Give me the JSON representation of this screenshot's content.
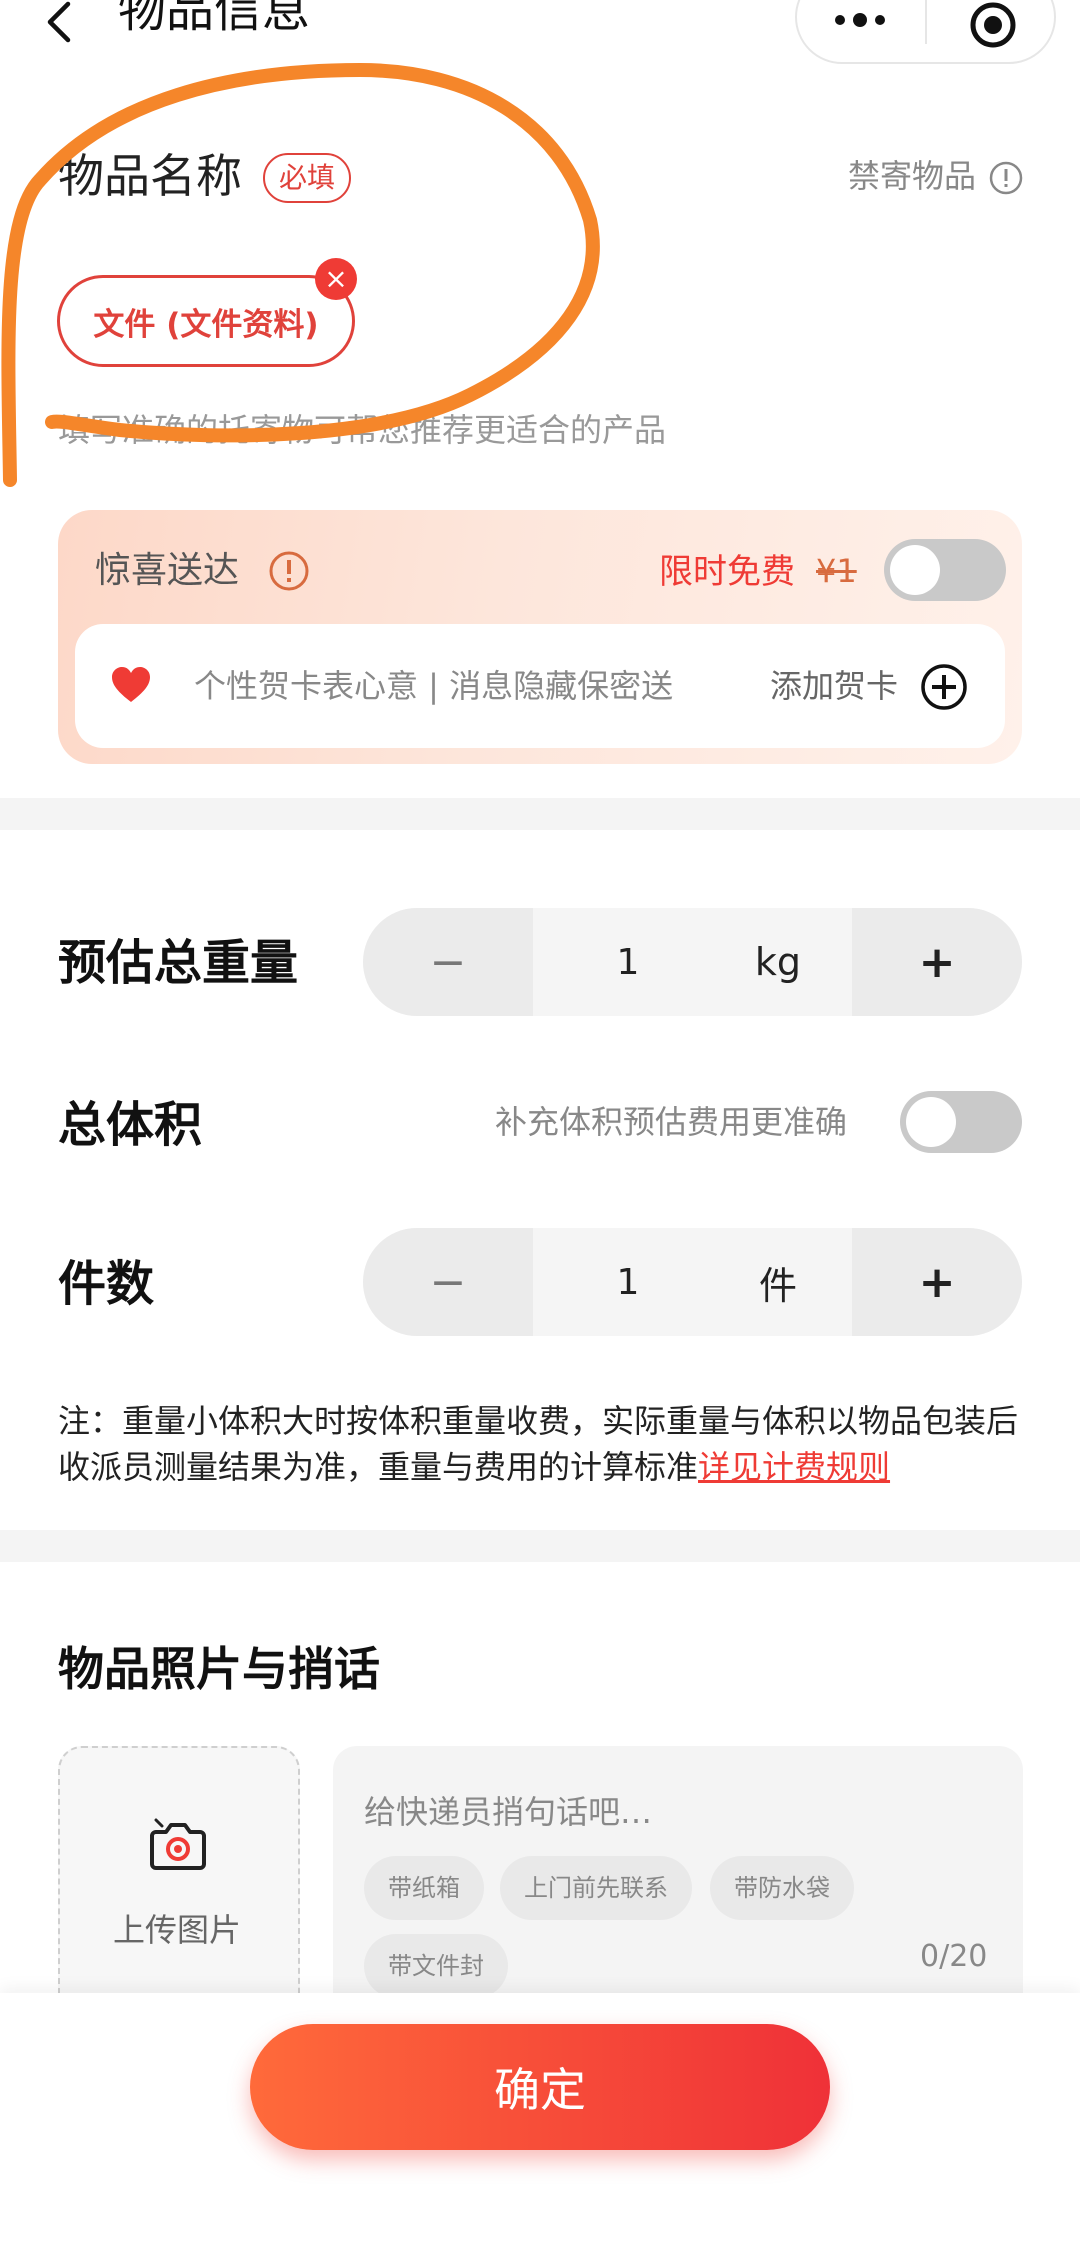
{
  "header": {
    "title": "物品信息",
    "back_icon": "chevron-left-icon",
    "more_icon": "more-dots-icon",
    "close_icon": "target-circle-icon"
  },
  "item_name": {
    "label": "物品名称",
    "required_badge": "必填",
    "forbidden_link": "禁寄物品",
    "selected_chip": "文件 (文件资料)",
    "chip_remove": "×",
    "hint": "填写准确的托寄物可帮您推荐更适合的产品"
  },
  "surprise": {
    "title": "惊喜送达",
    "limited_free": "限时免费",
    "old_price": "¥1",
    "toggle_on": false,
    "card_desc": "个性贺卡表心意 | 消息隐藏保密送",
    "add_card": "添加贺卡"
  },
  "weight": {
    "label": "预估总重量",
    "minus": "−",
    "value": "1",
    "unit": "kg",
    "plus": "+"
  },
  "volume": {
    "label": "总体积",
    "hint": "补充体积预估费用更准确",
    "toggle_on": false
  },
  "count": {
    "label": "件数",
    "minus": "−",
    "value": "1",
    "unit": "件",
    "plus": "+"
  },
  "note": {
    "text": "注：重量小体积大时按体积重量收费，实际重量与体积以物品包装后收派员测量结果为准，重量与费用的计算标准",
    "link": "详见计费规则"
  },
  "photos": {
    "title": "物品照片与捎话",
    "upload_label": "上传图片",
    "message_placeholder": "给快递员捎句话吧…",
    "tags": [
      "带纸箱",
      "上门前先联系",
      "带防水袋",
      "带文件封"
    ],
    "char_count": "0/20"
  },
  "footer": {
    "confirm": "确定"
  },
  "colors": {
    "accent": "#ef3b35",
    "annotation": "#f5862a"
  }
}
